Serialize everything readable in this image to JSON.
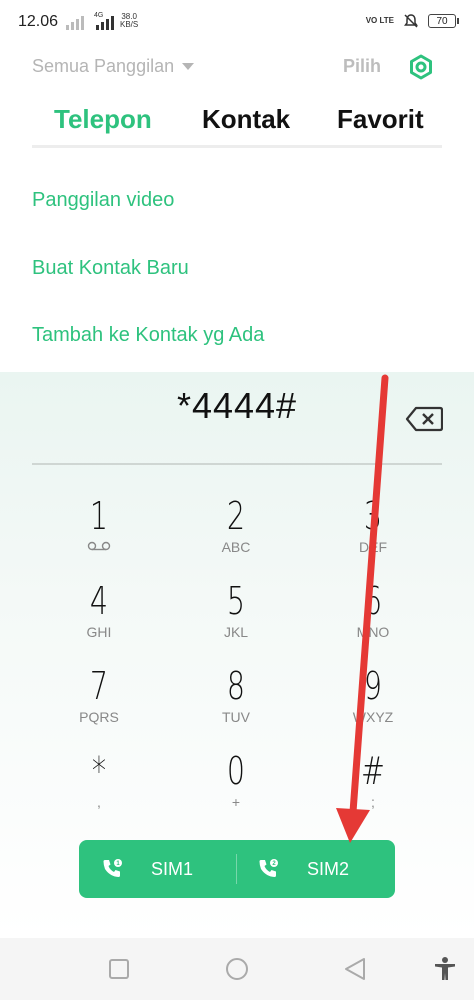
{
  "status_bar": {
    "time": "12.06",
    "network_speed_value": "38.0",
    "network_speed_unit": "KB/S",
    "network_type": "4G",
    "volte": "VO LTE",
    "battery": "70"
  },
  "header": {
    "filter_label": "Semua Panggilan",
    "select_label": "Pilih"
  },
  "tabs": [
    {
      "label": "Telepon",
      "active": true
    },
    {
      "label": "Kontak",
      "active": false
    },
    {
      "label": "Favorit",
      "active": false
    }
  ],
  "menu": [
    {
      "label": "Panggilan video"
    },
    {
      "label": "Buat Kontak Baru"
    },
    {
      "label": "Tambah ke Kontak yg Ada"
    }
  ],
  "dialer": {
    "number": "*4444#",
    "keys": [
      {
        "digit": "1",
        "letters": ""
      },
      {
        "digit": "2",
        "letters": "ABC"
      },
      {
        "digit": "3",
        "letters": "DEF"
      },
      {
        "digit": "4",
        "letters": "GHI"
      },
      {
        "digit": "5",
        "letters": "JKL"
      },
      {
        "digit": "6",
        "letters": "MNO"
      },
      {
        "digit": "7",
        "letters": "PQRS"
      },
      {
        "digit": "8",
        "letters": "TUV"
      },
      {
        "digit": "9",
        "letters": "WXYZ"
      },
      {
        "digit": "*",
        "letters": ","
      },
      {
        "digit": "0",
        "letters": "+"
      },
      {
        "digit": "#",
        "letters": ";"
      }
    ]
  },
  "call_buttons": {
    "sim1_label": "SIM1",
    "sim2_label": "SIM2"
  },
  "colors": {
    "accent": "#2ec27e",
    "annotation_arrow": "#e53935"
  }
}
